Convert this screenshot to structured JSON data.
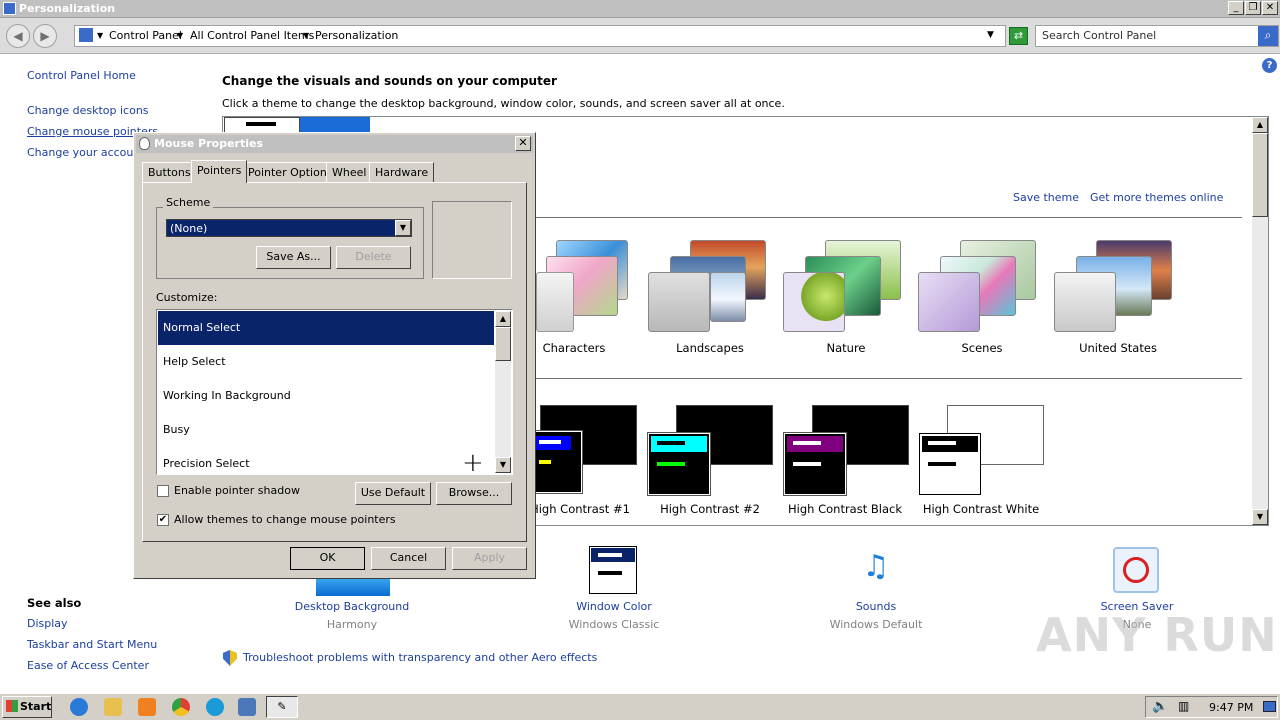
{
  "window": {
    "title": "Personalization"
  },
  "address": {
    "crumbs": [
      "Control Panel",
      "All Control Panel Items",
      "Personalization"
    ],
    "search_placeholder": "Search Control Panel"
  },
  "sidebar": {
    "home": "Control Panel Home",
    "links": [
      "Change desktop icons",
      "Change mouse pointers",
      "Change your account picture"
    ],
    "see_also_title": "See also",
    "see_also": [
      "Display",
      "Taskbar and Start Menu",
      "Ease of Access Center"
    ]
  },
  "main": {
    "heading": "Change the visuals and sounds on your computer",
    "subheading": "Click a theme to change the desktop background, window color, sounds, and screen saver all at once.",
    "save_theme": "Save theme",
    "get_more": "Get more themes online",
    "aero_themes": [
      "Characters",
      "Landscapes",
      "Nature",
      "Scenes",
      "United States"
    ],
    "hc_themes": [
      "High Contrast #1",
      "High Contrast #2",
      "High Contrast Black",
      "High Contrast White"
    ],
    "bottom": [
      {
        "title": "Desktop Background",
        "sub": "Harmony"
      },
      {
        "title": "Window Color",
        "sub": "Windows Classic"
      },
      {
        "title": "Sounds",
        "sub": "Windows Default"
      },
      {
        "title": "Screen Saver",
        "sub": "None"
      }
    ],
    "troubleshoot": "Troubleshoot problems with transparency and other Aero effects"
  },
  "dialog": {
    "title": "Mouse Properties",
    "tabs": [
      "Buttons",
      "Pointers",
      "Pointer Options",
      "Wheel",
      "Hardware"
    ],
    "scheme_label": "Scheme",
    "scheme_value": "(None)",
    "save_as": "Save As...",
    "delete": "Delete",
    "customize_label": "Customize:",
    "pointers": [
      "Normal Select",
      "Help Select",
      "Working In Background",
      "Busy",
      "Precision Select"
    ],
    "enable_shadow": "Enable pointer shadow",
    "enable_shadow_checked": false,
    "allow_themes": "Allow themes to change mouse pointers",
    "allow_themes_checked": true,
    "use_default": "Use Default",
    "browse": "Browse...",
    "ok": "OK",
    "cancel": "Cancel",
    "apply": "Apply"
  },
  "taskbar": {
    "start": "Start",
    "clock": "9:47 PM"
  },
  "watermark": "ANY RUN"
}
